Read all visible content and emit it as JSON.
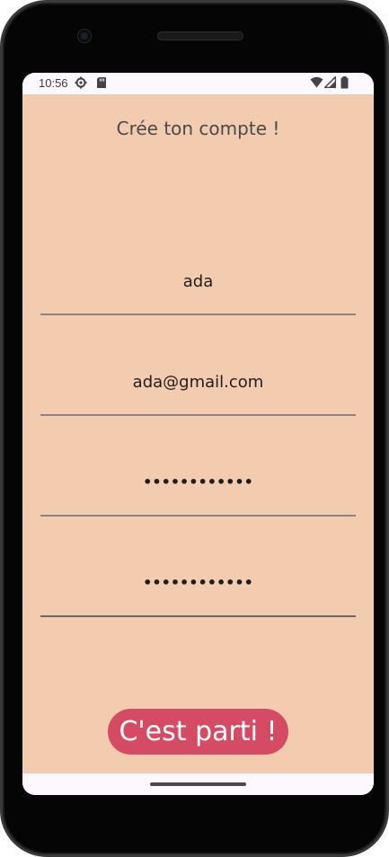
{
  "status_bar": {
    "time": "10:56",
    "icons": [
      "settings-icon",
      "sd-card-icon",
      "wifi-icon",
      "cell-signal-icon",
      "battery-icon"
    ]
  },
  "form": {
    "title": "Crée ton compte !",
    "fields": [
      {
        "name": "username",
        "value": "ada"
      },
      {
        "name": "email",
        "value": "ada@gmail.com"
      },
      {
        "name": "password",
        "value": "••••••••••••"
      },
      {
        "name": "password-confirm",
        "value": "••••••••••••"
      }
    ],
    "submit_label": "C'est parti !"
  },
  "colors": {
    "background": "#f3cbae",
    "button": "#d64b64",
    "button_text": "#ffffff"
  }
}
